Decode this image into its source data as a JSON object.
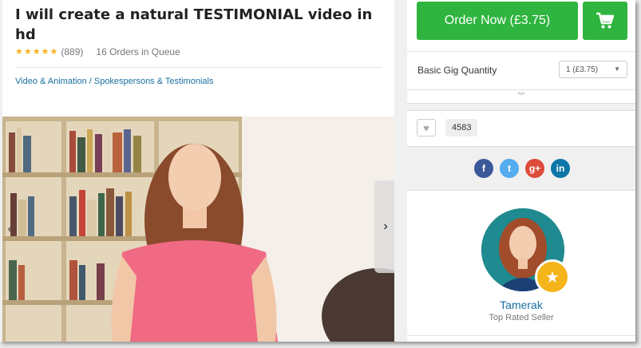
{
  "gig": {
    "title": "I will create a natural TESTIMONIAL video in hd",
    "rating_count": "(889)",
    "orders_in_queue": "16 Orders in Queue",
    "rating_stars": 5,
    "breadcrumb": "Video & Animation / Spokespersons & Testimonials"
  },
  "gallery": {
    "prev_icon": "chevron-left-icon",
    "next_icon": "chevron-right-icon",
    "prev_glyph": "‹",
    "next_glyph": "›"
  },
  "order": {
    "button_label": "Order Now (£3.75)",
    "cart_icon": "cart-icon",
    "quantity_label": "Basic Gig Quantity",
    "quantity_value": "1 (£3.75)",
    "expand_glyph": "︾"
  },
  "favorites": {
    "heart_glyph": "♥",
    "count": "4583"
  },
  "share": [
    {
      "name": "facebook-icon",
      "glyph": "f",
      "color": "#3b5998"
    },
    {
      "name": "twitter-icon",
      "glyph": "t",
      "color": "#55acee"
    },
    {
      "name": "google-plus-icon",
      "glyph": "g+",
      "color": "#dd4b39"
    },
    {
      "name": "linkedin-icon",
      "glyph": "in",
      "color": "#0e76a8"
    }
  ],
  "seller": {
    "name": "Tamerak",
    "level": "Top Rated Seller",
    "badge_glyph": "★"
  },
  "colors": {
    "brand_green": "#2fb53f",
    "link_blue": "#1a6fa0",
    "star_gold": "#f6b01e",
    "badge_gold": "#f4b41a"
  }
}
